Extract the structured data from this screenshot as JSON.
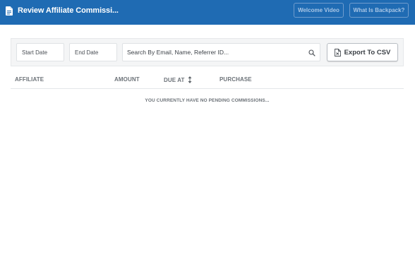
{
  "header": {
    "title": "Review Affiliate Commissi...",
    "title_icon": "document-icon",
    "welcome_video_label": "Welcome Video",
    "backpack_label": "What Is Backpack?",
    "background_color": "#1f6bb3"
  },
  "filters": {
    "start_date_placeholder": "Start Date",
    "end_date_placeholder": "End Date",
    "search_placeholder": "Search By Email, Name, Referrer ID...",
    "search_icon": "search-icon",
    "export_label": "Export To CSV",
    "export_icon": "csv-file-icon"
  },
  "table": {
    "columns": [
      "AFFILIATE",
      "AMOUNT",
      "DUE AT",
      "PURCHASE"
    ],
    "sort_icon": "sort-arrows-icon",
    "rows": [],
    "empty_message": "YOU CURRENTLY HAVE NO PENDING COMMISSIONS..."
  }
}
